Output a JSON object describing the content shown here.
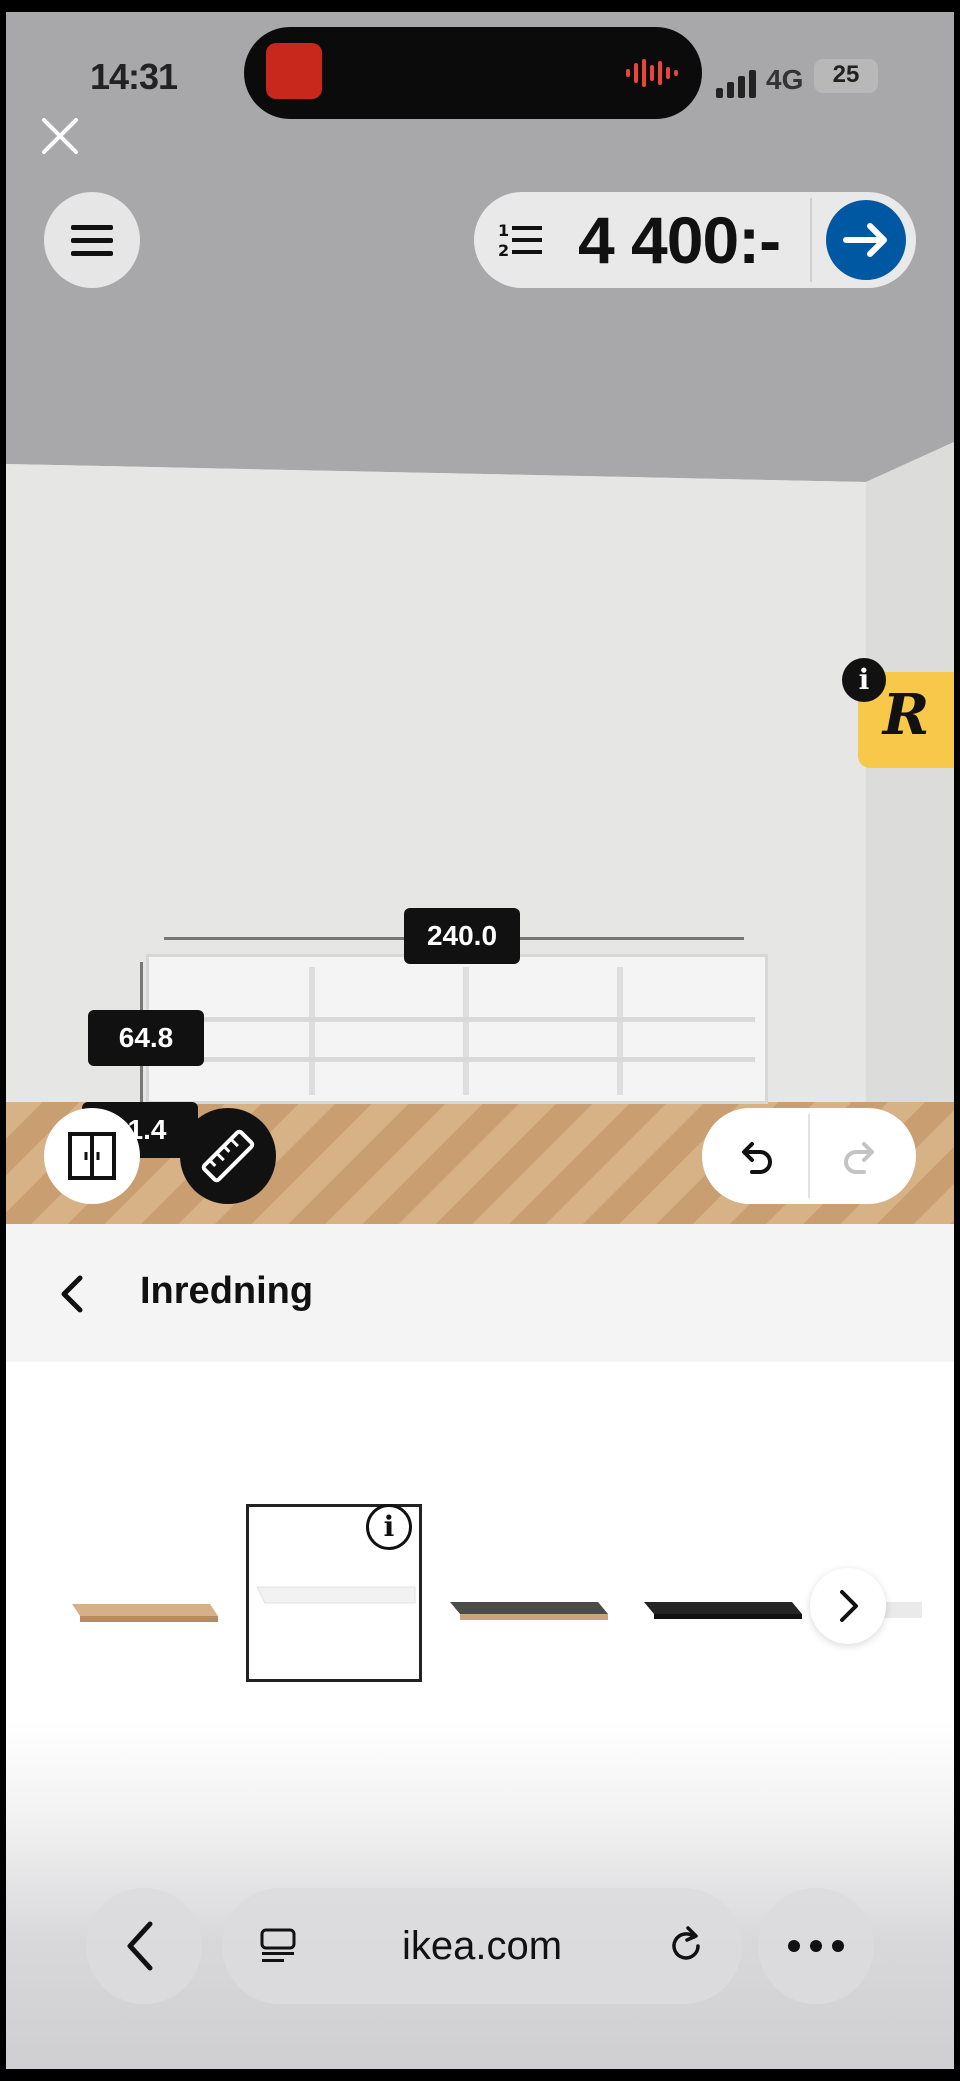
{
  "status_bar": {
    "time": "14:31",
    "network": "4G",
    "battery": "25"
  },
  "toolbar": {
    "price": "4 400:-"
  },
  "dimensions": {
    "width": "240.0",
    "depth": "64.8",
    "height": "11.4"
  },
  "badge": {
    "letter": "R"
  },
  "panel": {
    "title": "Inredning"
  },
  "options": [
    {
      "name": "oak-shelf",
      "color": "#c9a47c"
    },
    {
      "name": "white-shelf",
      "color": "#f3f3f3",
      "selected": true
    },
    {
      "name": "dark-grey-shelf",
      "color": "#4b4b47"
    },
    {
      "name": "black-shelf",
      "color": "#222222"
    }
  ],
  "browser": {
    "url": "ikea.com"
  },
  "colors": {
    "accent_blue": "#0058a3",
    "badge_yellow": "#f7c84a"
  }
}
